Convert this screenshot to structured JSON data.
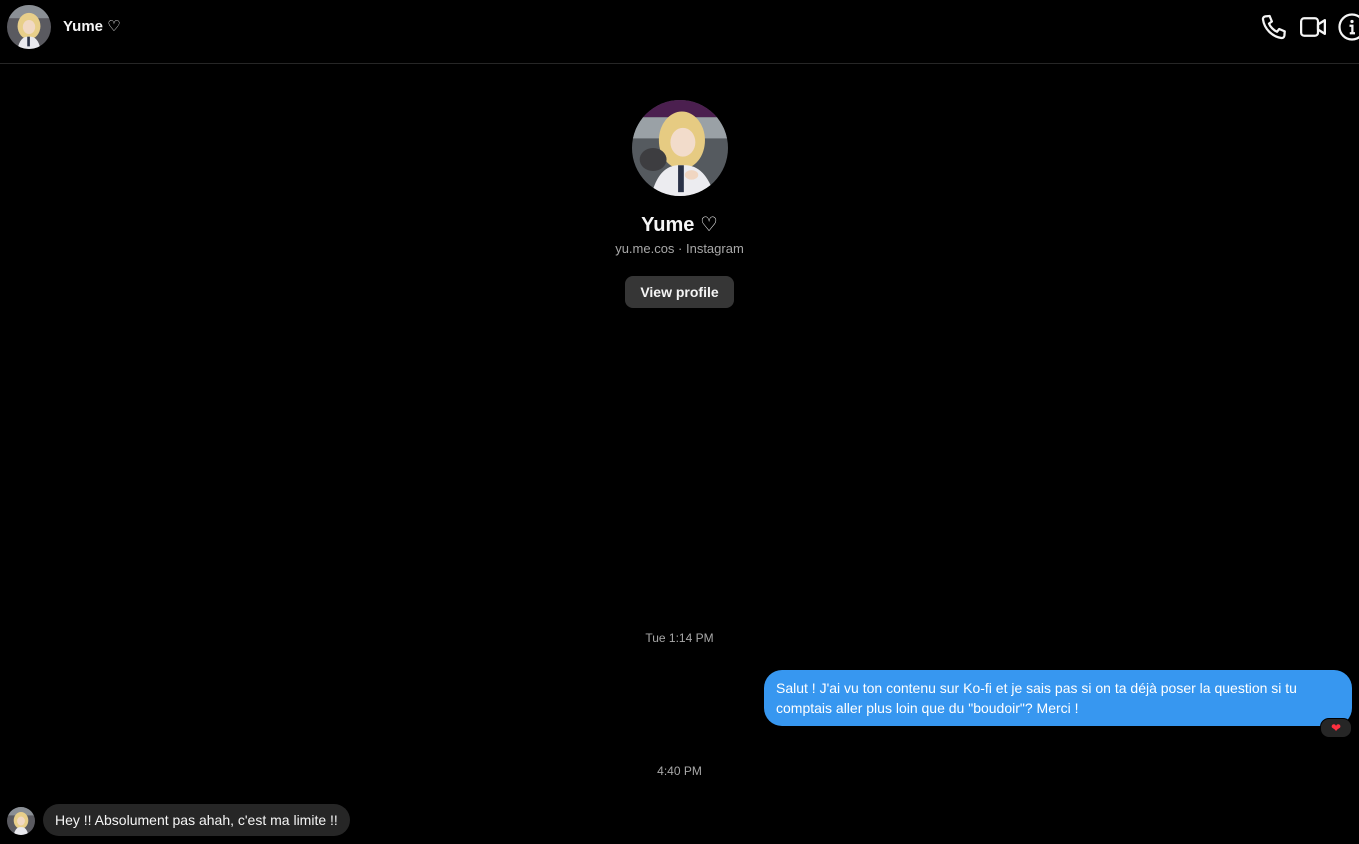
{
  "header": {
    "name": "Yume ♡",
    "actions": [
      {
        "icon": "phone-icon"
      },
      {
        "icon": "video-call-icon"
      },
      {
        "icon": "info-icon"
      }
    ]
  },
  "profile": {
    "name": "Yume ♡",
    "subtitle": "yu.me.cos · Instagram",
    "view_profile_label": "View profile"
  },
  "conversation": {
    "timestamp_1": "Tue 1:14 PM",
    "outgoing_message": "Salut ! J'ai vu ton contenu sur Ko-fi et je sais pas si on ta déjà poser la question si tu comptais aller plus loin que du \"boudoir\"? Merci !",
    "outgoing_reaction": "❤",
    "timestamp_2": "4:40 PM",
    "incoming_message": "Hey !! Absolument pas ahah, c'est ma limite !!"
  },
  "colors": {
    "background": "#000000",
    "outgoing_bubble": "#3797f0",
    "incoming_bubble": "#262626",
    "secondary_text": "#a8a8a8",
    "reaction_heart": "#ff3040"
  }
}
